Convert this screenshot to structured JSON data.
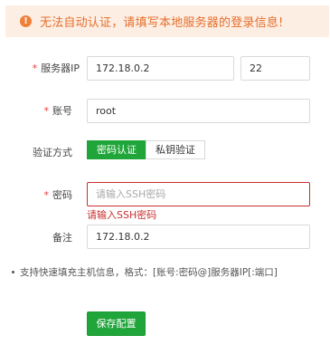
{
  "alert": {
    "icon": "exclamation-circle-icon",
    "message": "无法自动认证，请填写本地服务器的登录信息!",
    "color": "#e56f2c",
    "background": "#fdeee4"
  },
  "form": {
    "required_mark": "*",
    "server_ip": {
      "label": "服务器IP",
      "value": "172.18.0.2",
      "port_value": "22"
    },
    "account": {
      "label": "账号",
      "value": "root"
    },
    "auth_method": {
      "label": "验证方式",
      "options": [
        "密码认证",
        "私钥验证"
      ],
      "selected": "密码认证"
    },
    "password": {
      "label": "密码",
      "placeholder": "请输入SSH密码",
      "value": "",
      "error": "请输入SSH密码"
    },
    "remark": {
      "label": "备注",
      "value": "172.18.0.2"
    }
  },
  "tip": "支持快速填充主机信息，格式：[账号:密码@]服务器IP[:端口]",
  "save_button": "保存配置",
  "colors": {
    "accent": "#20a53a",
    "error": "#c82f2f"
  }
}
